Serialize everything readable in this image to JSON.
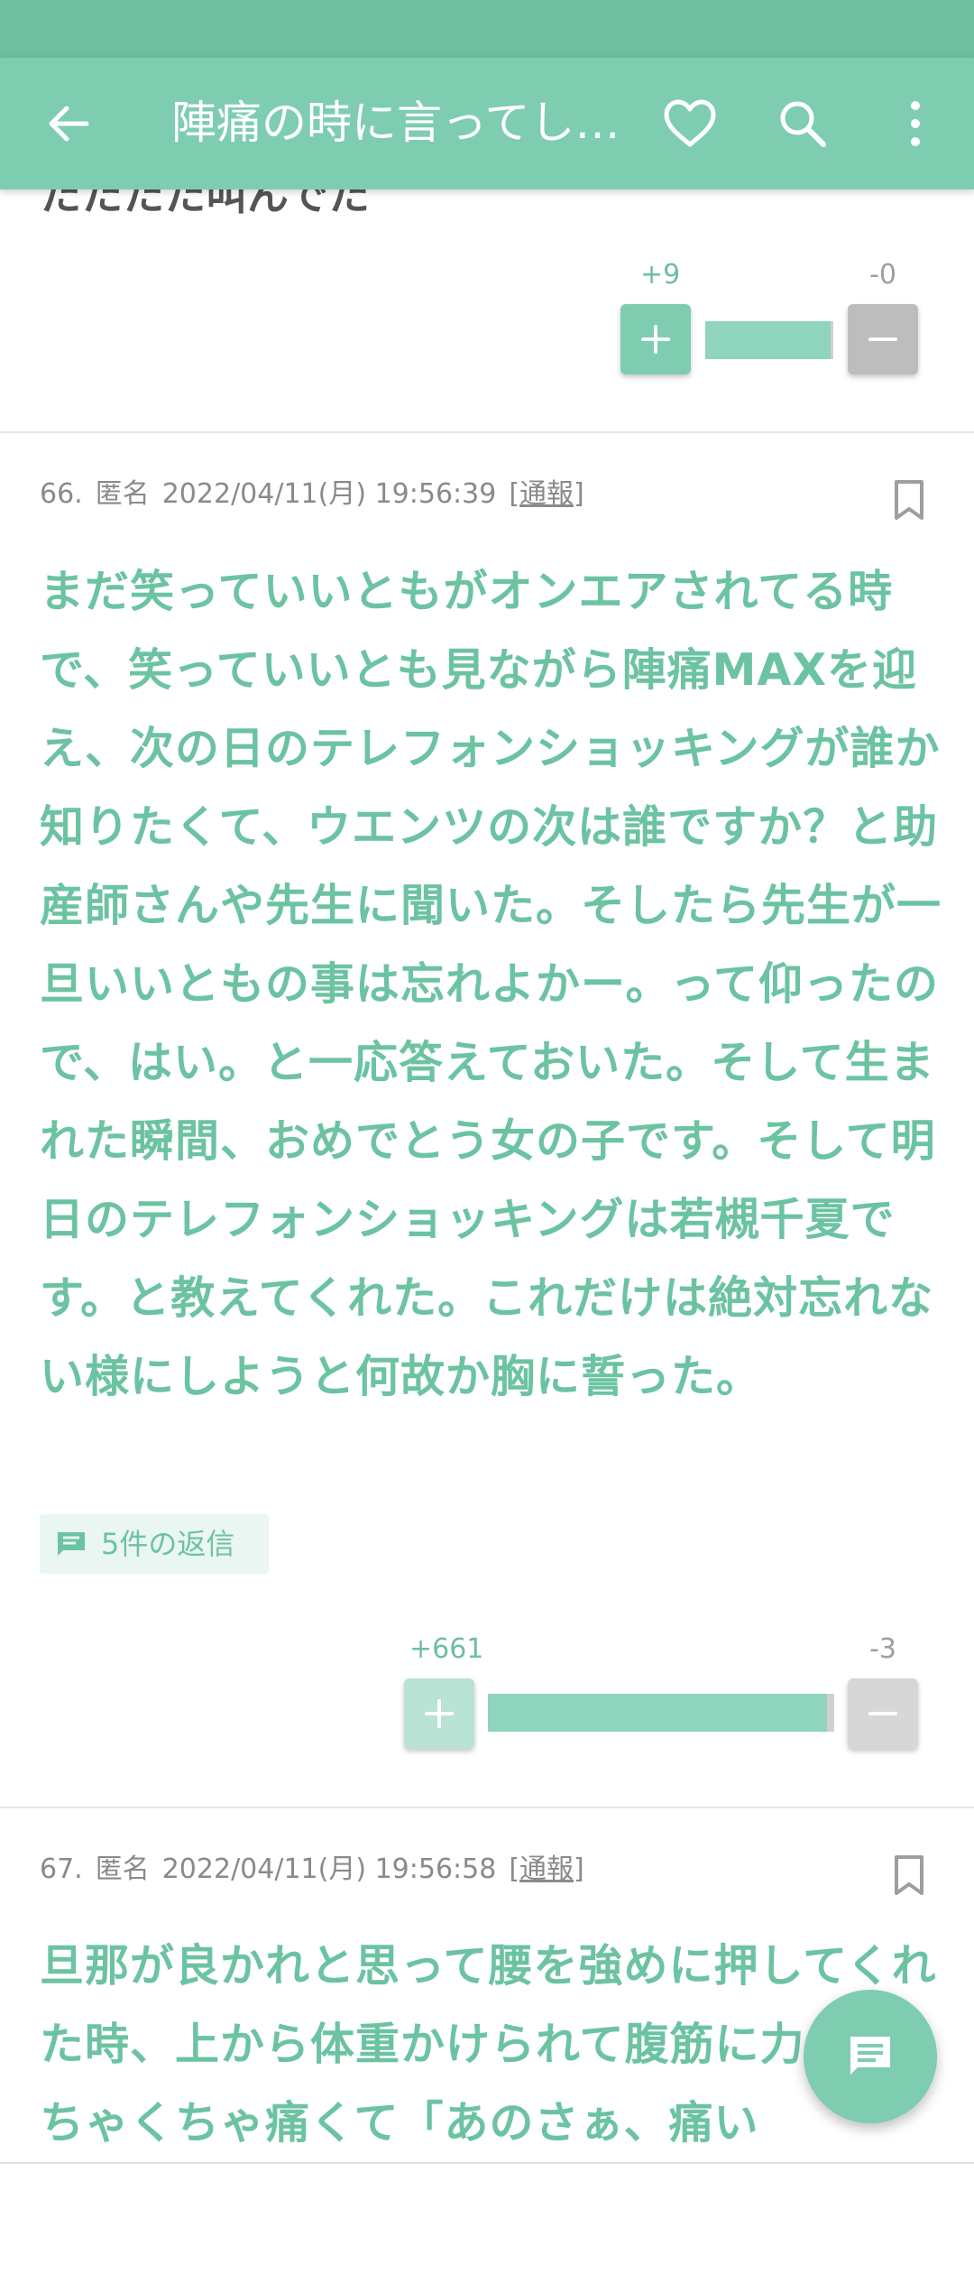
{
  "app_bar": {
    "title": "陣痛の時に言ってし…"
  },
  "colors": {
    "accent": "#7ecdb1",
    "status_bar": "#6dbfa0",
    "comment_text": "#6cc3a1"
  },
  "icons": {
    "back": "arrow-left-icon",
    "favorite": "heart-icon",
    "search": "search-icon",
    "more": "more-vert-icon",
    "bookmark": "bookmark-icon",
    "reply": "comment-icon",
    "fab": "compose-comment-icon"
  },
  "prev_comment": {
    "partial_text": "たたたた叫んでた",
    "plus_count": "+9",
    "minus_count": "-0",
    "plus_ratio": 0.98
  },
  "comment_66": {
    "number": "66.",
    "author": "匿名",
    "datetime": "2022/04/11(月) 19:56:39",
    "report_open": "[",
    "report_label": "通報",
    "report_close": "]",
    "body": "まだ笑っていいともがオンエアされてる時で、笑っていいとも見ながら陣痛MAXを迎え、次の日のテレフォンショッキングが誰か知りたくて、ウエンツの次は誰ですか？と助産師さんや先生に聞いた。そしたら先生が一旦いいともの事は忘れよかー。って仰ったので、はい。と一応答えておいた。そして生まれた瞬間、おめでとう女の子です。そして明日のテレフォンショッキングは若槻千夏です。と教えてくれた。これだけは絶対忘れない様にしようと何故か胸に誓った。",
    "replies_label": "5件の返信",
    "plus_count": "+661",
    "minus_count": "-3",
    "plus_ratio": 0.98
  },
  "comment_67": {
    "number": "67.",
    "author": "匿名",
    "datetime": "2022/04/11(月) 19:56:58",
    "report_open": "[",
    "report_label": "通報",
    "report_close": "]",
    "body": "旦那が良かれと思って腰を強めに押してくれた時、上から体重かけられて腹筋に力入りめちゃくちゃ痛くて「あのさぁ、痛い"
  }
}
